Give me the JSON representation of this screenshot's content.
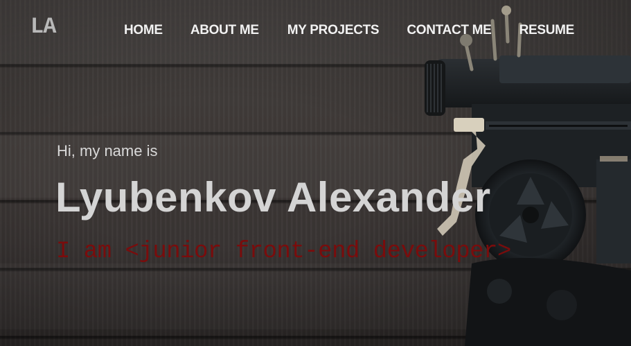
{
  "header": {
    "logo": "LA",
    "nav": [
      "HOME",
      "ABOUT ME",
      "MY PROJECTS",
      "CONTACT ME",
      "RESUME"
    ]
  },
  "hero": {
    "greeting": "Hi, my name is",
    "name": "Lyubenkov Alexander",
    "role": "I am <junior front-end developer>"
  },
  "colors": {
    "role_text": "#7a0c0c",
    "name_text": "#d4d4d4",
    "nav_text": "#f2f2f2",
    "logo_text": "#b9b9b9",
    "background": "#3d3836"
  },
  "images": {
    "background": "dark wooden planks",
    "hero_image": "vintage typewriter"
  }
}
